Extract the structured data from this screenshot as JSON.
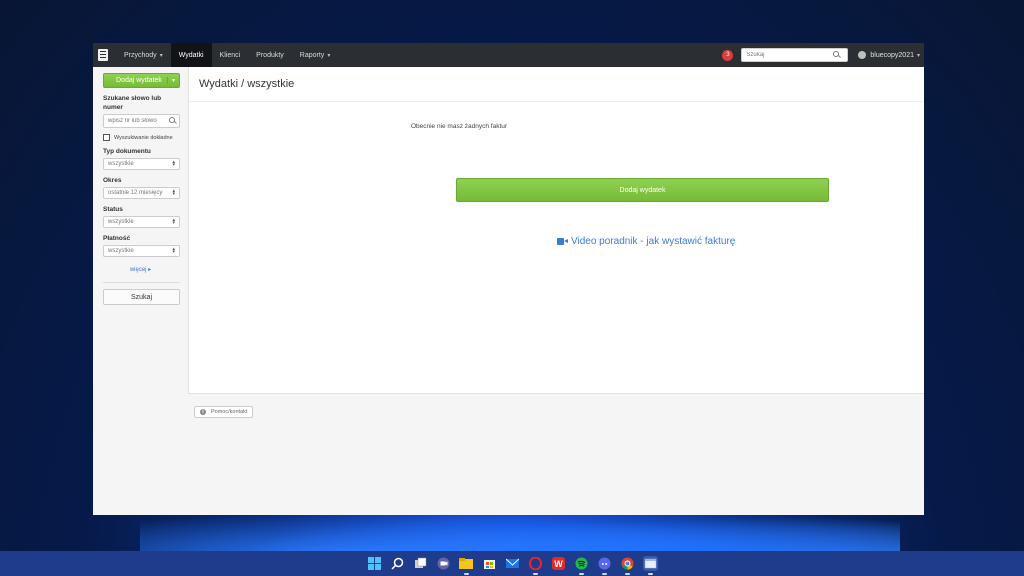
{
  "topnav": {
    "items": [
      {
        "label": "Przychody",
        "has_caret": true
      },
      {
        "label": "Wydatki",
        "active": true
      },
      {
        "label": "Klienci"
      },
      {
        "label": "Produkty"
      },
      {
        "label": "Raporty",
        "has_caret": true
      }
    ],
    "notifications_count": "3",
    "search_placeholder": "Szukaj",
    "username": "bluecopy2021"
  },
  "sidebar": {
    "add_button": "Dodaj wydatek",
    "search_label": "Szukane słowo lub numer",
    "search_placeholder": "wpisz nr lub słowo",
    "exact_search_label": "Wyszukiwanie dokładne",
    "doc_type_label": "Typ dokumentu",
    "doc_type_value": "wszystkie",
    "period_label": "Okres",
    "period_value": "ostatnie 12 miesięcy",
    "status_label": "Status",
    "status_value": "wszystkie",
    "payment_label": "Płatność",
    "payment_value": "wszystkie",
    "more_link": "więcej",
    "search_button": "Szukaj"
  },
  "main": {
    "title": "Wydatki / wszystkie",
    "empty_message": "Obecnie nie masz żadnych faktur",
    "add_button": "Dodaj wydatek",
    "video_link": "Video poradnik - jak wystawić fakturę"
  },
  "footer": {
    "help_label": "Pomoc/kontakt"
  },
  "colors": {
    "accent_green": "#80c242",
    "link_blue": "#3a7bd5",
    "nav_bg": "#2b2f33",
    "badge_red": "#e23b3b"
  },
  "taskbar": {
    "icons": [
      "windows-start-icon",
      "search-icon",
      "task-view-icon",
      "teams-chat-icon",
      "file-explorer-icon",
      "store-icon",
      "mail-icon",
      "opera-icon",
      "wps-office-icon",
      "spotify-icon",
      "discord-icon",
      "chrome-icon",
      "app-window-icon"
    ]
  }
}
